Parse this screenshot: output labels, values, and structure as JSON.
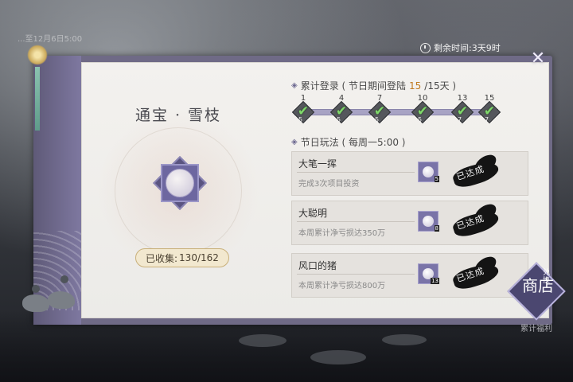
{
  "header": {
    "timer_label": "剩余时间:3天9时",
    "background_hint": "...至12月6日5:00"
  },
  "item": {
    "title": "通宝 · 雪枝",
    "collected_label": "已收集:",
    "collected_value": "130/162"
  },
  "login": {
    "title_prefix": "累计登录 ( 节日期间登陆",
    "current": "15",
    "title_suffix": "/15天 )",
    "days": [
      {
        "day": "1",
        "count": "5",
        "done": true
      },
      {
        "day": "4",
        "count": "5",
        "done": true
      },
      {
        "day": "7",
        "count": "5",
        "done": true
      },
      {
        "day": "10",
        "count": "5",
        "done": true
      },
      {
        "day": "13",
        "count": "7",
        "done": true
      },
      {
        "day": "15",
        "count": "7",
        "done": true
      }
    ]
  },
  "festival": {
    "title": "节日玩法 ( 每周一5:00 )",
    "tasks": [
      {
        "name": "大笔一挥",
        "desc": "完成3次项目投资",
        "reward_qty": "5",
        "status": "已达成"
      },
      {
        "name": "大聪明",
        "desc": "本周累计净亏损达350万",
        "reward_qty": "8",
        "status": "已达成"
      },
      {
        "name": "风口的猪",
        "desc": "本周累计净亏损达800万",
        "reward_qty": "13",
        "status": "已达成"
      }
    ]
  },
  "shop": {
    "big_label": "商店",
    "small_label": "兑换",
    "caption": "累计福利"
  },
  "icons": {
    "close": "close-icon",
    "timer": "clock-icon",
    "section": "diamond-bullet-icon",
    "check": "check-icon"
  },
  "colors": {
    "accent": "#6f6a86",
    "highlight": "#c07a20",
    "check": "#7fd86a"
  }
}
